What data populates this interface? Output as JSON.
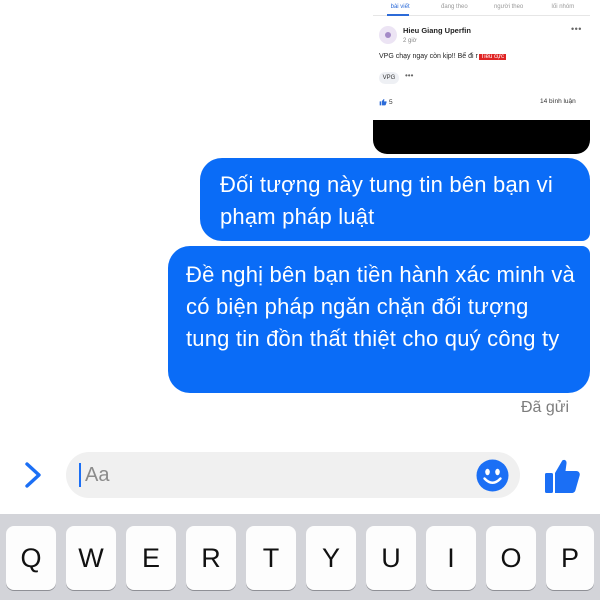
{
  "shared_post": {
    "tabs": [
      {
        "label": "bài viết",
        "active": true
      },
      {
        "label": "đang theo",
        "active": false
      },
      {
        "label": "người theo",
        "active": false
      },
      {
        "label": "lối nhóm",
        "active": false
      }
    ],
    "author": "Hieu Giang Uperfin",
    "time": "2 giờ",
    "text": "VPG chạy ngay còn kịp!! Bế đi r",
    "tag": "Tiêu cực",
    "stock": "VPG",
    "stock_more": "•••",
    "likes": "5",
    "comments": "14 bình luận",
    "more": "•••"
  },
  "messages": [
    {
      "text": "Đối tượng này tung tin bên bạn vi phạm pháp luật"
    },
    {
      "text": "Đề nghị bên bạn tiền hành xác minh và có biện pháp ngăn chặn đối tượng tung tin đồn thất thiệt cho quý công ty"
    }
  ],
  "status": "Đã gửi",
  "composer": {
    "placeholder": "Aa",
    "icons": {
      "expand": "chevron-right-icon",
      "emoji": "smiley-icon",
      "like": "thumbs-up-icon"
    }
  },
  "keyboard": {
    "row1": [
      "Q",
      "W",
      "E",
      "R",
      "T",
      "Y",
      "U",
      "I",
      "O",
      "P"
    ]
  },
  "colors": {
    "bubble": "#0a6cf7",
    "accent": "#1b6ff5",
    "keyboard_bg": "#d3d4d9"
  }
}
